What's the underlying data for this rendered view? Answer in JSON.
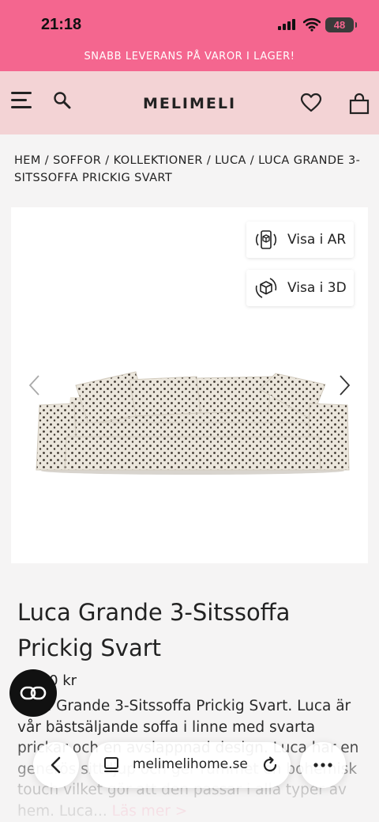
{
  "status_bar": {
    "time": "21:18",
    "battery": "48"
  },
  "announcement": "SNABB LEVERANS PÅ VAROR I LAGER!",
  "header": {
    "logo": "MELIMELI"
  },
  "breadcrumb": {
    "items": [
      "HEM",
      "SOFFOR",
      "KOLLEKTIONER",
      "LUCA",
      "LUCA GRANDE 3-SITSSOFFA PRICKIG SVART"
    ],
    "separator": " / "
  },
  "product": {
    "view_ar_label": "Visa i AR",
    "view_3d_label": "Visa i 3D",
    "title": "Luca Grande 3-Sitssoffa Prickig Svart",
    "price": "25.00 kr",
    "description": "Luca Grande 3-Sitssoffa Prickig Svart. Luca är vår bästsäljande soffa i linne med svarta prickar och en avslappnad design. Luca har en generös sittdjup och ger rummet en bohemisk touch vilket gör att den passar i alla typer av hem. Luca...",
    "read_more": "Läs mer >"
  },
  "browser": {
    "url": "melimelihome.se"
  },
  "colors": {
    "accent_pink": "#f4668f",
    "header_bg": "#f3d3d5"
  }
}
